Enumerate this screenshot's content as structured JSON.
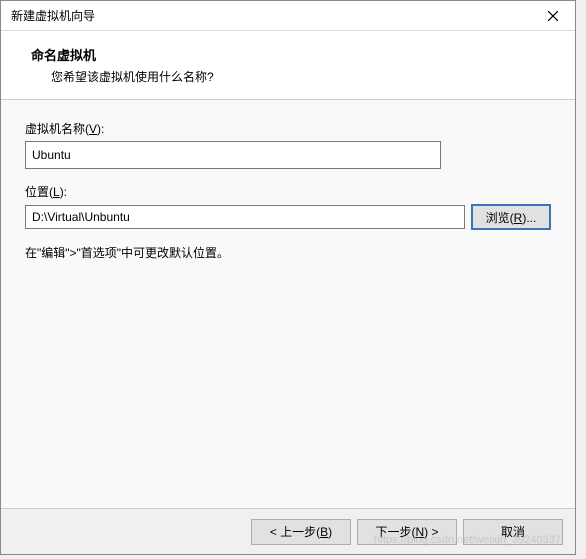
{
  "titlebar": {
    "title": "新建虚拟机向导"
  },
  "header": {
    "title": "命名虚拟机",
    "subtitle": "您希望该虚拟机使用什么名称?"
  },
  "fields": {
    "name": {
      "label_prefix": "虚拟机名称(",
      "label_hotkey": "V",
      "label_suffix": "):",
      "value": "Ubuntu"
    },
    "location": {
      "label_prefix": "位置(",
      "label_hotkey": "L",
      "label_suffix": "):",
      "value": "D:\\Virtual\\Unbuntu",
      "browse_prefix": "浏览(",
      "browse_hotkey": "R",
      "browse_suffix": ")..."
    }
  },
  "hint": "在\"编辑\">\"首选项\"中可更改默认位置。",
  "footer": {
    "back_prefix": "< 上一步(",
    "back_hotkey": "B",
    "back_suffix": ")",
    "next_prefix": "下一步(",
    "next_hotkey": "N",
    "next_suffix": ") >",
    "cancel": "取消"
  },
  "watermark": "https://blog.csdn.net/weixin_39240337"
}
